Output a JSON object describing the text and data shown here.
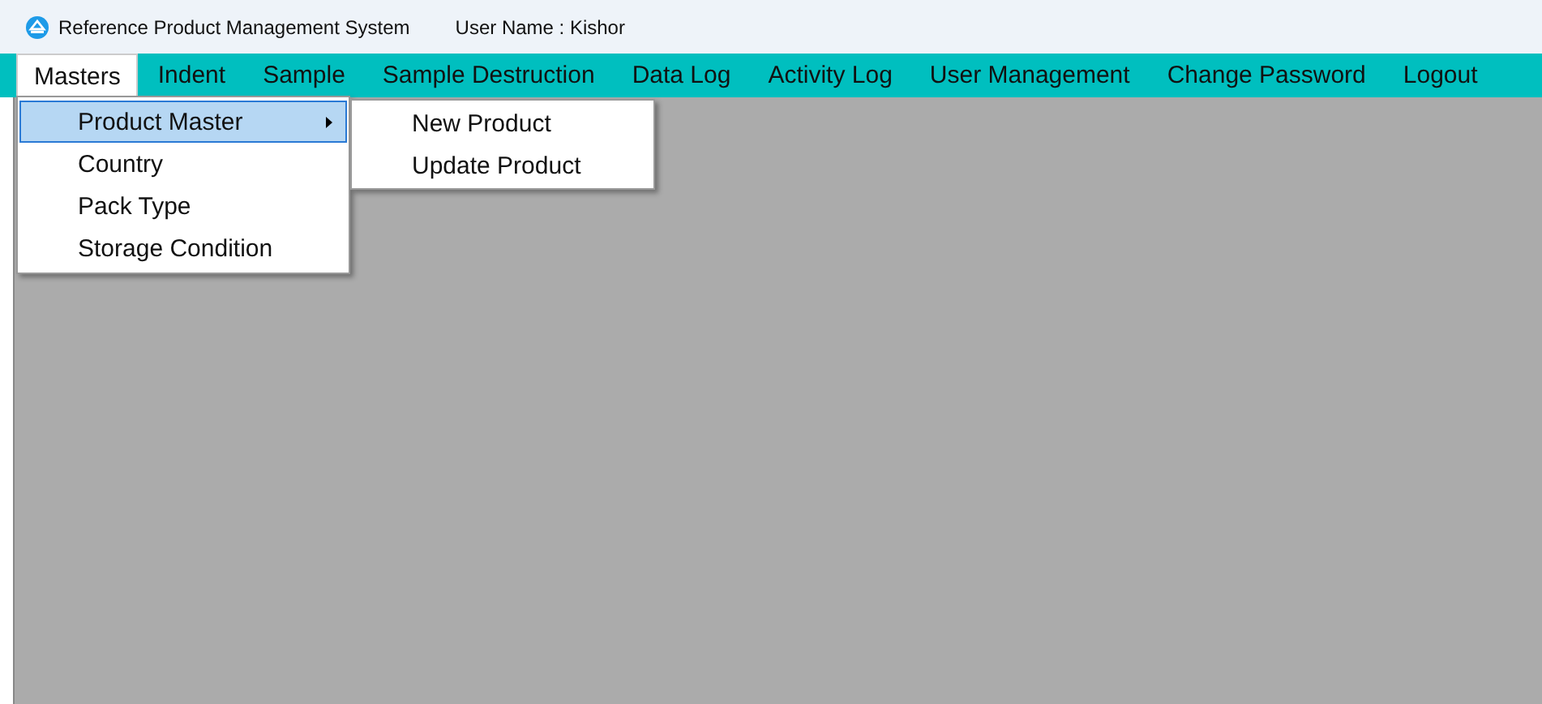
{
  "window": {
    "title": "Reference Product Management System",
    "user": "User Name : Kishor"
  },
  "menu_bar": [
    {
      "label": "Masters",
      "selected": true
    },
    {
      "label": "Indent",
      "selected": false
    },
    {
      "label": "Sample",
      "selected": false
    },
    {
      "label": "Sample Destruction",
      "selected": false
    },
    {
      "label": "Data Log",
      "selected": false
    },
    {
      "label": "Activity Log",
      "selected": false
    },
    {
      "label": "User Management",
      "selected": false
    },
    {
      "label": "Change Password",
      "selected": false
    },
    {
      "label": "Logout",
      "selected": false
    }
  ],
  "dropdown": [
    {
      "label": "Product Master",
      "selected": true,
      "has_submenu": true
    },
    {
      "label": "Country",
      "selected": false,
      "has_submenu": false
    },
    {
      "label": "Pack Type",
      "selected": false,
      "has_submenu": false
    },
    {
      "label": "Storage Condition",
      "selected": false,
      "has_submenu": false
    }
  ],
  "submenu": [
    {
      "label": "New Product",
      "selected": false
    },
    {
      "label": "Update Product",
      "selected": false
    }
  ]
}
